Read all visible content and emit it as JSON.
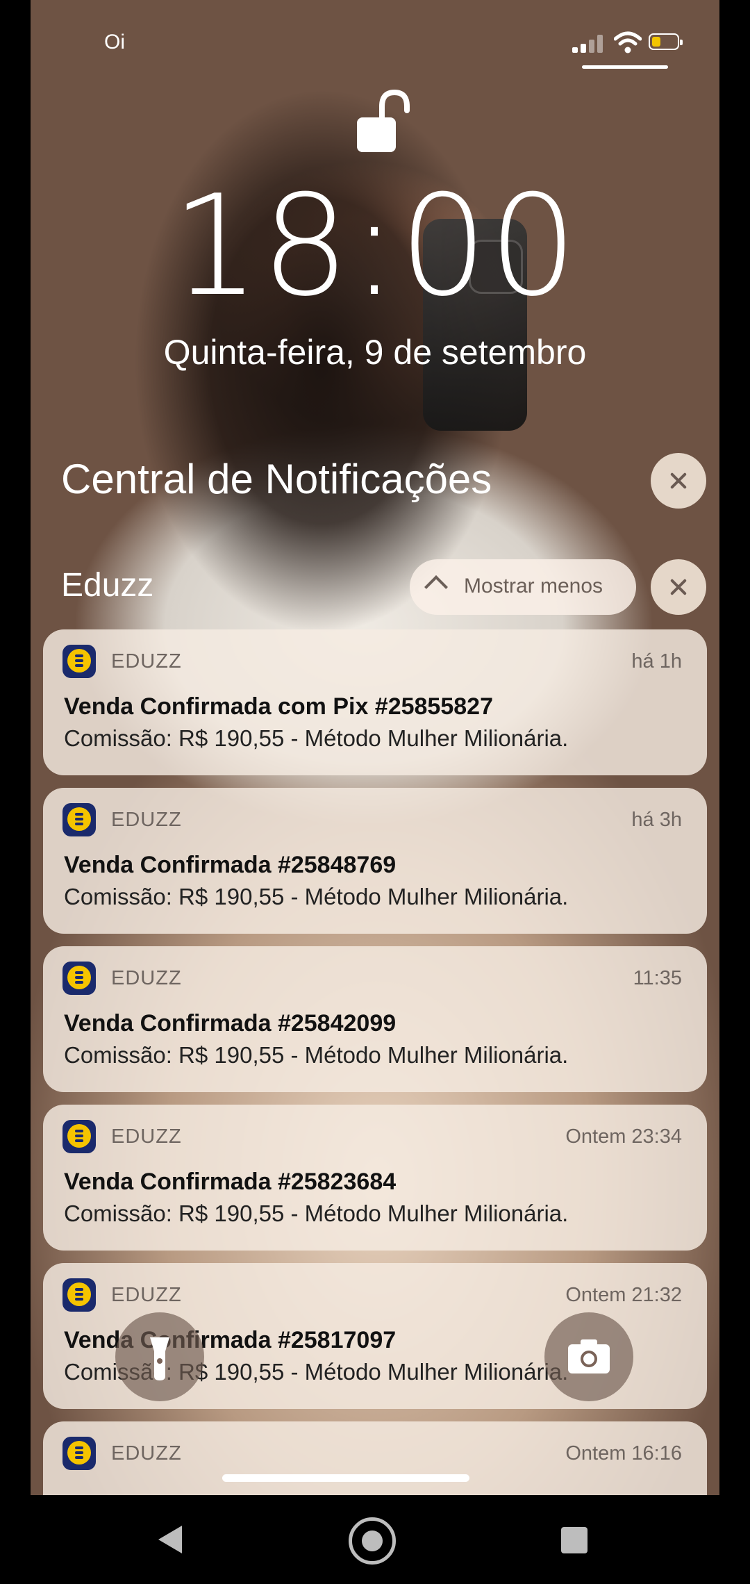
{
  "status_bar": {
    "carrier": "Oi"
  },
  "lock_screen": {
    "time": "18:00",
    "date": "Quinta-feira, 9 de setembro"
  },
  "notification_center": {
    "title": "Central de Notificações",
    "group": {
      "name": "Eduzz",
      "show_less_label": "Mostrar menos"
    },
    "notifications": [
      {
        "app": "EDUZZ",
        "time": "há 1h",
        "title": "Venda Confirmada com Pix #25855827",
        "body": "Comissão: R$ 190,55 - Método Mulher Milionária."
      },
      {
        "app": "EDUZZ",
        "time": "há 3h",
        "title": "Venda Confirmada #25848769",
        "body": "Comissão: R$ 190,55 - Método Mulher Milionária."
      },
      {
        "app": "EDUZZ",
        "time": "11:35",
        "title": "Venda Confirmada #25842099",
        "body": "Comissão: R$ 190,55 - Método Mulher Milionária."
      },
      {
        "app": "EDUZZ",
        "time": "Ontem 23:34",
        "title": "Venda Confirmada #25823684",
        "body": "Comissão: R$ 190,55 - Método Mulher Milionária."
      },
      {
        "app": "EDUZZ",
        "time": "Ontem 21:32",
        "title": "Venda Confirmada #25817097",
        "body": "Comissão: R$ 190,55 - Método Mulher Milionária."
      },
      {
        "app": "EDUZZ",
        "time": "Ontem 16:16",
        "title": "",
        "body": ""
      }
    ]
  },
  "icons": {
    "flashlight": "flashlight-icon",
    "camera": "camera-icon",
    "lock": "unlocked-padlock-icon"
  },
  "colors": {
    "eduzz_blue": "#1a2a6c",
    "eduzz_yellow": "#f5c400",
    "battery_low": "#f2c500"
  }
}
